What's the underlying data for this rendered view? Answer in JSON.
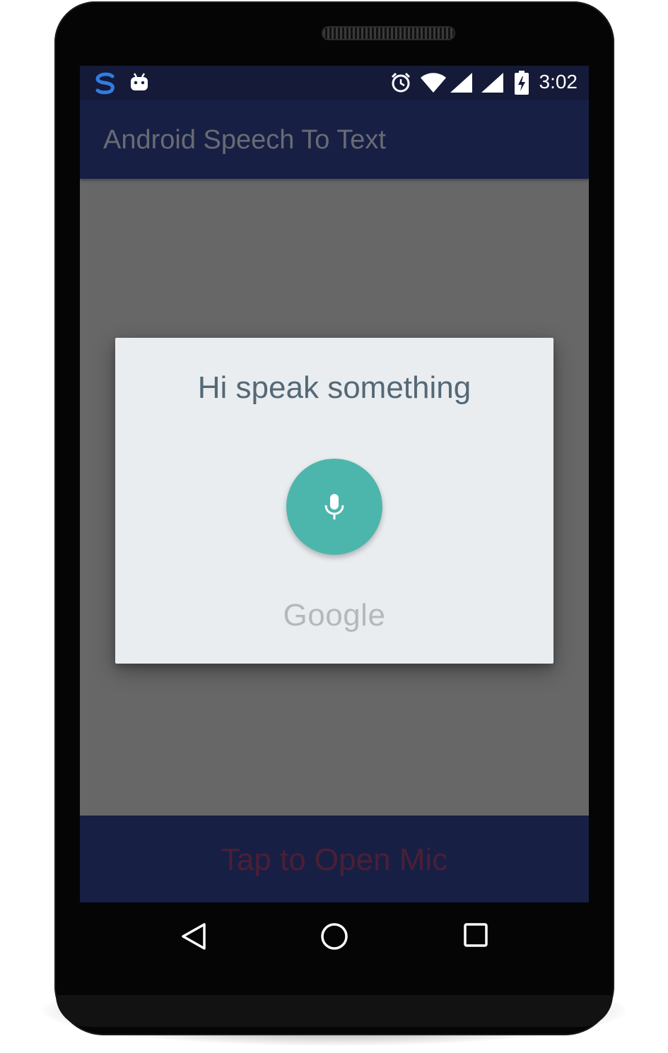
{
  "status_bar": {
    "time": "3:02",
    "left_icons": [
      "s-app-icon",
      "android-debug-icon"
    ],
    "right_icons": [
      "alarm-icon",
      "wifi-icon",
      "signal-icon",
      "signal-icon",
      "battery-charging-icon"
    ]
  },
  "app_bar": {
    "title": "Android Speech To Text"
  },
  "speech_dialog": {
    "prompt": "Hi speak something",
    "mic_icon": "microphone-icon",
    "mic_color": "#4db6ac",
    "brand": "Google"
  },
  "bottom_button": {
    "label": "Tap to Open Mic"
  },
  "nav_bar": {
    "buttons": [
      "back-icon",
      "home-icon",
      "recents-icon"
    ]
  },
  "colors": {
    "status_bar": "#141a38",
    "app_bar": "#181f45",
    "scrim": "#676767",
    "dialog_bg": "#eaedf0"
  }
}
